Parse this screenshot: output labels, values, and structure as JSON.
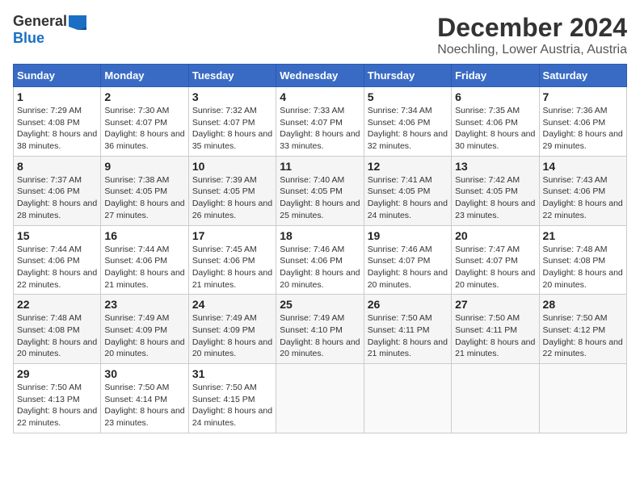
{
  "logo": {
    "general": "General",
    "blue": "Blue"
  },
  "title": "December 2024",
  "location": "Noechling, Lower Austria, Austria",
  "days_of_week": [
    "Sunday",
    "Monday",
    "Tuesday",
    "Wednesday",
    "Thursday",
    "Friday",
    "Saturday"
  ],
  "weeks": [
    [
      {
        "day": "1",
        "sunrise": "7:29 AM",
        "sunset": "4:08 PM",
        "daylight": "8 hours and 38 minutes."
      },
      {
        "day": "2",
        "sunrise": "7:30 AM",
        "sunset": "4:07 PM",
        "daylight": "8 hours and 36 minutes."
      },
      {
        "day": "3",
        "sunrise": "7:32 AM",
        "sunset": "4:07 PM",
        "daylight": "8 hours and 35 minutes."
      },
      {
        "day": "4",
        "sunrise": "7:33 AM",
        "sunset": "4:07 PM",
        "daylight": "8 hours and 33 minutes."
      },
      {
        "day": "5",
        "sunrise": "7:34 AM",
        "sunset": "4:06 PM",
        "daylight": "8 hours and 32 minutes."
      },
      {
        "day": "6",
        "sunrise": "7:35 AM",
        "sunset": "4:06 PM",
        "daylight": "8 hours and 30 minutes."
      },
      {
        "day": "7",
        "sunrise": "7:36 AM",
        "sunset": "4:06 PM",
        "daylight": "8 hours and 29 minutes."
      }
    ],
    [
      {
        "day": "8",
        "sunrise": "7:37 AM",
        "sunset": "4:06 PM",
        "daylight": "8 hours and 28 minutes."
      },
      {
        "day": "9",
        "sunrise": "7:38 AM",
        "sunset": "4:05 PM",
        "daylight": "8 hours and 27 minutes."
      },
      {
        "day": "10",
        "sunrise": "7:39 AM",
        "sunset": "4:05 PM",
        "daylight": "8 hours and 26 minutes."
      },
      {
        "day": "11",
        "sunrise": "7:40 AM",
        "sunset": "4:05 PM",
        "daylight": "8 hours and 25 minutes."
      },
      {
        "day": "12",
        "sunrise": "7:41 AM",
        "sunset": "4:05 PM",
        "daylight": "8 hours and 24 minutes."
      },
      {
        "day": "13",
        "sunrise": "7:42 AM",
        "sunset": "4:05 PM",
        "daylight": "8 hours and 23 minutes."
      },
      {
        "day": "14",
        "sunrise": "7:43 AM",
        "sunset": "4:06 PM",
        "daylight": "8 hours and 22 minutes."
      }
    ],
    [
      {
        "day": "15",
        "sunrise": "7:44 AM",
        "sunset": "4:06 PM",
        "daylight": "8 hours and 22 minutes."
      },
      {
        "day": "16",
        "sunrise": "7:44 AM",
        "sunset": "4:06 PM",
        "daylight": "8 hours and 21 minutes."
      },
      {
        "day": "17",
        "sunrise": "7:45 AM",
        "sunset": "4:06 PM",
        "daylight": "8 hours and 21 minutes."
      },
      {
        "day": "18",
        "sunrise": "7:46 AM",
        "sunset": "4:06 PM",
        "daylight": "8 hours and 20 minutes."
      },
      {
        "day": "19",
        "sunrise": "7:46 AM",
        "sunset": "4:07 PM",
        "daylight": "8 hours and 20 minutes."
      },
      {
        "day": "20",
        "sunrise": "7:47 AM",
        "sunset": "4:07 PM",
        "daylight": "8 hours and 20 minutes."
      },
      {
        "day": "21",
        "sunrise": "7:48 AM",
        "sunset": "4:08 PM",
        "daylight": "8 hours and 20 minutes."
      }
    ],
    [
      {
        "day": "22",
        "sunrise": "7:48 AM",
        "sunset": "4:08 PM",
        "daylight": "8 hours and 20 minutes."
      },
      {
        "day": "23",
        "sunrise": "7:49 AM",
        "sunset": "4:09 PM",
        "daylight": "8 hours and 20 minutes."
      },
      {
        "day": "24",
        "sunrise": "7:49 AM",
        "sunset": "4:09 PM",
        "daylight": "8 hours and 20 minutes."
      },
      {
        "day": "25",
        "sunrise": "7:49 AM",
        "sunset": "4:10 PM",
        "daylight": "8 hours and 20 minutes."
      },
      {
        "day": "26",
        "sunrise": "7:50 AM",
        "sunset": "4:11 PM",
        "daylight": "8 hours and 21 minutes."
      },
      {
        "day": "27",
        "sunrise": "7:50 AM",
        "sunset": "4:11 PM",
        "daylight": "8 hours and 21 minutes."
      },
      {
        "day": "28",
        "sunrise": "7:50 AM",
        "sunset": "4:12 PM",
        "daylight": "8 hours and 22 minutes."
      }
    ],
    [
      {
        "day": "29",
        "sunrise": "7:50 AM",
        "sunset": "4:13 PM",
        "daylight": "8 hours and 22 minutes."
      },
      {
        "day": "30",
        "sunrise": "7:50 AM",
        "sunset": "4:14 PM",
        "daylight": "8 hours and 23 minutes."
      },
      {
        "day": "31",
        "sunrise": "7:50 AM",
        "sunset": "4:15 PM",
        "daylight": "8 hours and 24 minutes."
      },
      null,
      null,
      null,
      null
    ]
  ]
}
